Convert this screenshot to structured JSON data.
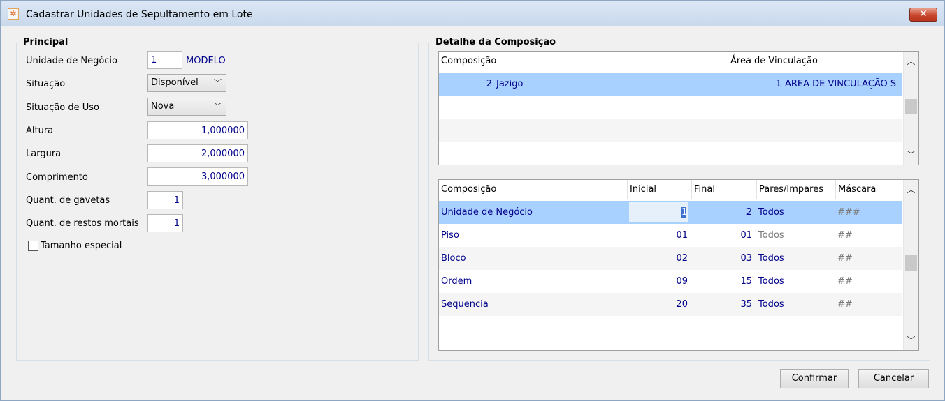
{
  "window": {
    "title": "Cadastrar Unidades de Sepultamento em Lote",
    "close_label": "✕"
  },
  "principal": {
    "title": "Principal",
    "unidade_negocio": {
      "label": "Unidade de Negócio",
      "value": "1",
      "name": "MODELO"
    },
    "situacao": {
      "label": "Situação",
      "value": "Disponível"
    },
    "situacao_uso": {
      "label": "Situação de Uso",
      "value": "Nova"
    },
    "altura": {
      "label": "Altura",
      "value": "1,000000"
    },
    "largura": {
      "label": "Largura",
      "value": "2,000000"
    },
    "comprimento": {
      "label": "Comprimento",
      "value": "3,000000"
    },
    "gavetas": {
      "label": "Quant. de gavetas",
      "value": "1"
    },
    "restos": {
      "label": "Quant. de restos mortais",
      "value": "1"
    },
    "tamanho_especial": {
      "label": "Tamanho especial",
      "checked": false
    }
  },
  "detalhe": {
    "title": "Detalhe da Composição",
    "grid1": {
      "headers": [
        "Composição",
        "Área de Vinculação"
      ],
      "rows": [
        {
          "comp_num": "2",
          "comp_name": "Jazigo",
          "area_num": "1",
          "area_name": "AREA DE VINCULAÇÃO S"
        }
      ]
    },
    "grid2": {
      "headers": [
        "Composição",
        "Inicial",
        "Final",
        "Pares/Impares",
        "Máscara"
      ],
      "rows": [
        {
          "composicao": "Unidade de Negócio",
          "inicial": "1",
          "final": "2",
          "pares": "Todos",
          "mascara": "###"
        },
        {
          "composicao": "Piso",
          "inicial": "01",
          "final": "01",
          "pares": "Todos",
          "mascara": "##"
        },
        {
          "composicao": "Bloco",
          "inicial": "02",
          "final": "03",
          "pares": "Todos",
          "mascara": "##"
        },
        {
          "composicao": "Ordem",
          "inicial": "09",
          "final": "15",
          "pares": "Todos",
          "mascara": "##"
        },
        {
          "composicao": "Sequencia",
          "inicial": "20",
          "final": "35",
          "pares": "Todos",
          "mascara": "##"
        }
      ]
    }
  },
  "buttons": {
    "confirmar": "Confirmar",
    "cancelar": "Cancelar"
  }
}
